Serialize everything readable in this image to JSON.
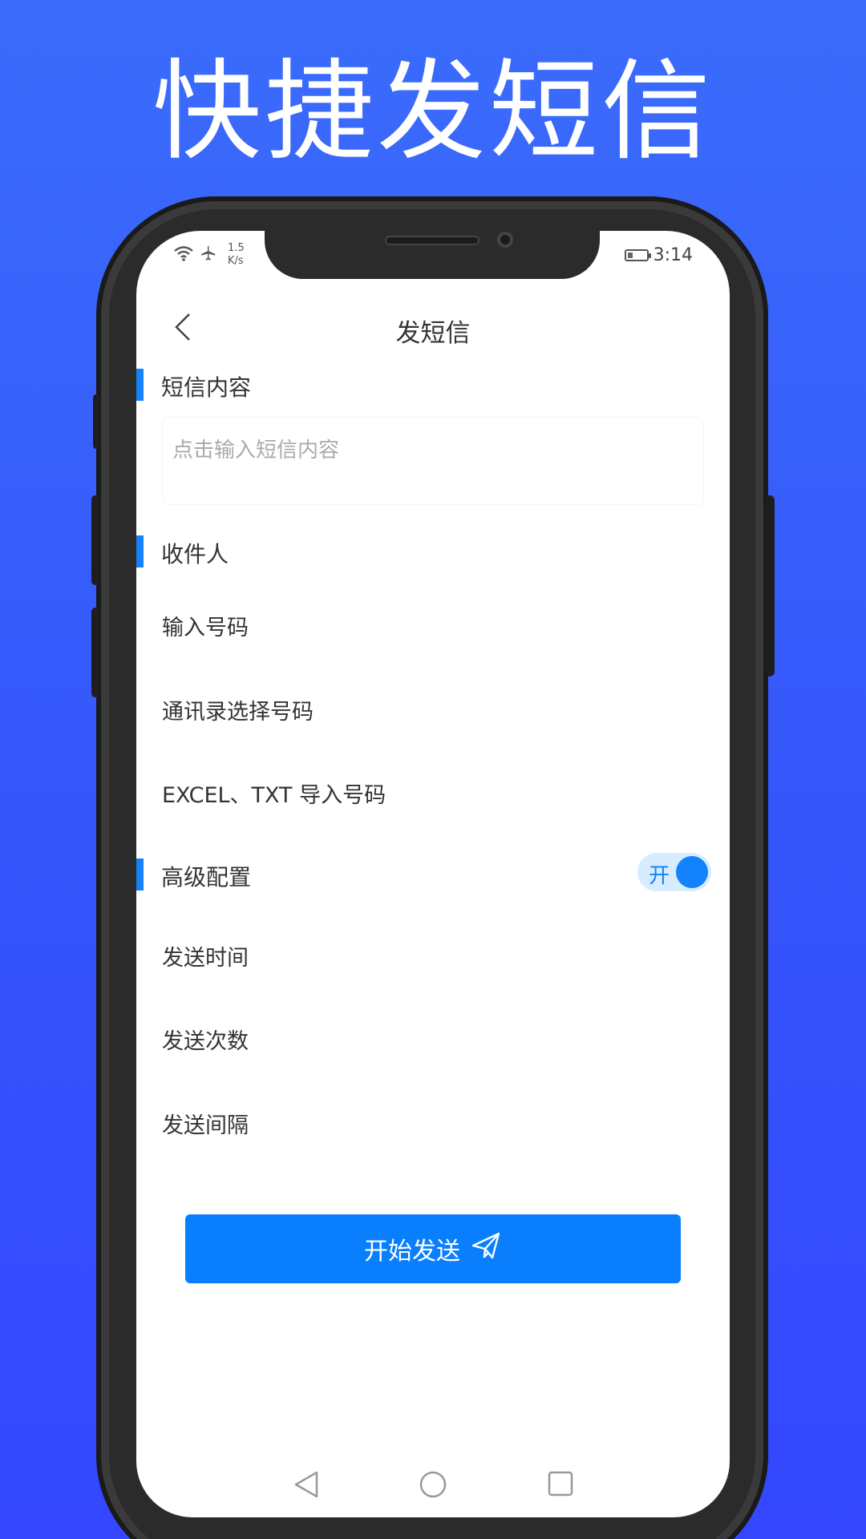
{
  "promo": {
    "title": "快捷发短信"
  },
  "status_bar": {
    "speed_value": "1.5",
    "speed_unit": "K/s",
    "time": "3:14",
    "battery_level": 0.25
  },
  "nav": {
    "title": "发短信"
  },
  "content_section": {
    "title": "短信内容",
    "placeholder": "点击输入短信内容"
  },
  "recipient_section": {
    "title": "收件人",
    "items": [
      "输入号码",
      "通讯录选择号码",
      "EXCEL、TXT 导入号码"
    ]
  },
  "advanced_section": {
    "title": "高级配置",
    "toggle_label": "开",
    "toggle_on": true,
    "items": [
      "发送时间",
      "发送次数",
      "发送间隔"
    ]
  },
  "send_button": {
    "label": "开始发送"
  },
  "colors": {
    "accent": "#1482fa",
    "button": "#0a7ffd",
    "background": "#3557fb"
  }
}
